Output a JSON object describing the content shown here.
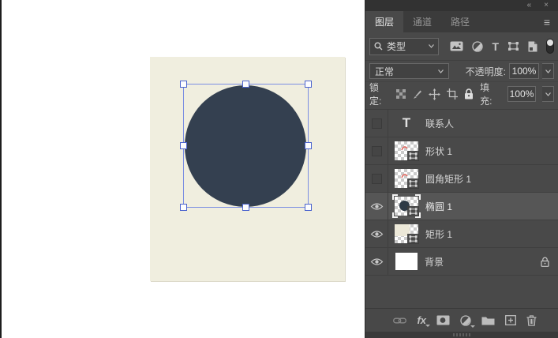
{
  "colors": {
    "panel_bg": "#494949",
    "panel_chrome": "#3b3b3b",
    "titlebar_bg": "#323232",
    "selected_row_bg": "#565656",
    "canvas_bg": "#f0eedf",
    "shape_fill": "#344050",
    "selection_accent": "#7b8ee2",
    "handle_border": "#4b63ce"
  },
  "window_controls": {
    "collapse_icon": "«",
    "close_icon": "×"
  },
  "panel": {
    "tabs": [
      {
        "label": "图层",
        "active": true
      },
      {
        "label": "通道",
        "active": false
      },
      {
        "label": "路径",
        "active": false
      }
    ],
    "menu_icon": "≡",
    "filter": {
      "kind_label": "类型",
      "type_filter_glyph": "T"
    },
    "blend": {
      "mode": "正常",
      "opacity_label": "不透明度:",
      "opacity_value": "100%"
    },
    "lock": {
      "label": "锁定:",
      "fill_label": "填充:",
      "fill_value": "100%"
    },
    "layers": [
      {
        "name": "联系人",
        "kind": "text",
        "thumb_glyph": "T",
        "visible": false,
        "selected": false,
        "locked": false
      },
      {
        "name": "形状 1",
        "kind": "shape",
        "visible": false,
        "selected": false,
        "locked": false
      },
      {
        "name": "圆角矩形 1",
        "kind": "shape",
        "visible": false,
        "selected": false,
        "locked": false
      },
      {
        "name": "椭圆 1",
        "kind": "shape",
        "visible": true,
        "selected": true,
        "locked": false
      },
      {
        "name": "矩形 1",
        "kind": "shape",
        "visible": true,
        "selected": false,
        "locked": false
      },
      {
        "name": "背景",
        "kind": "background",
        "visible": true,
        "selected": false,
        "locked": true
      }
    ],
    "footer": {
      "fx_label": "fx"
    }
  },
  "canvas": {
    "selected_layer": "椭圆 1",
    "selection_handles": 8
  }
}
